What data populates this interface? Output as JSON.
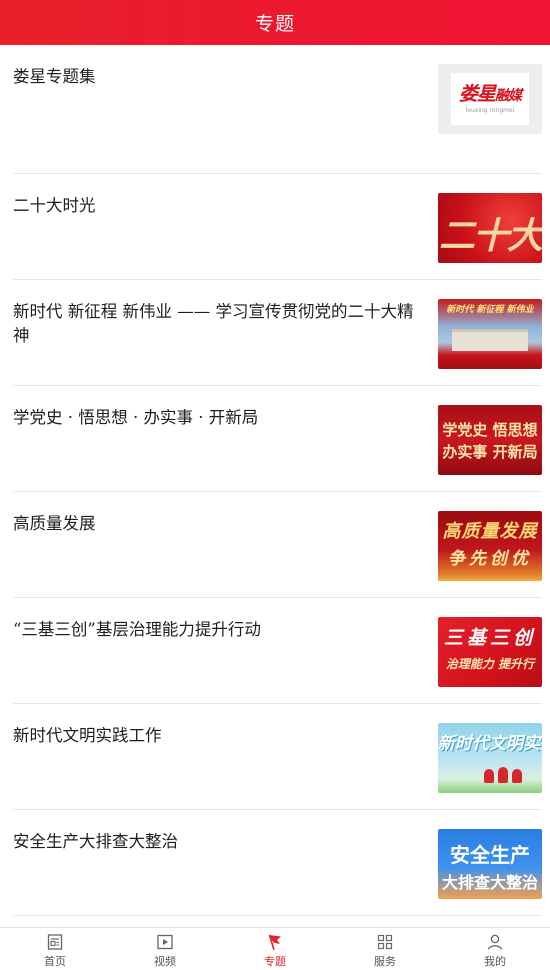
{
  "header": {
    "title": "专题"
  },
  "topics": [
    {
      "label": "娄星专题集",
      "thumb_text": [
        "娄星",
        "融媒"
      ],
      "thumb_caption": "louxing rongmei"
    },
    {
      "label": "二十大时光",
      "thumb_text": [
        "二十大"
      ]
    },
    {
      "label": "新时代 新征程 新伟业 —— 学习宣传贯彻党的二十大精神",
      "thumb_text": [
        "新时代 新征程 新伟业"
      ]
    },
    {
      "label": "学党史 · 悟思想 · 办实事 · 开新局",
      "thumb_text": [
        "学党史 悟思想",
        "办实事 开新局"
      ]
    },
    {
      "label": "高质量发展",
      "thumb_text": [
        "高质量发展",
        "争先创优"
      ]
    },
    {
      "label": "“三基三创”基层治理能力提升行动",
      "thumb_text": [
        "三基三创",
        "治理能力 提升行"
      ]
    },
    {
      "label": "新时代文明实践工作",
      "thumb_text": [
        "新时代文明实践"
      ]
    },
    {
      "label": "安全生产大排查大整治",
      "thumb_text": [
        "安全生产",
        "大排查大整治"
      ]
    }
  ],
  "tabbar": {
    "active": "专题",
    "tabs": [
      {
        "label": "首页",
        "icon": "newspaper-icon"
      },
      {
        "label": "视频",
        "icon": "play-icon"
      },
      {
        "label": "专题",
        "icon": "flag-icon"
      },
      {
        "label": "服务",
        "icon": "grid-icon"
      },
      {
        "label": "我的",
        "icon": "user-icon"
      }
    ]
  },
  "colors": {
    "brand": "#e8202a",
    "text": "#1e1e1e",
    "divider": "#e6e6e6",
    "tab_inactive": "#555555"
  }
}
